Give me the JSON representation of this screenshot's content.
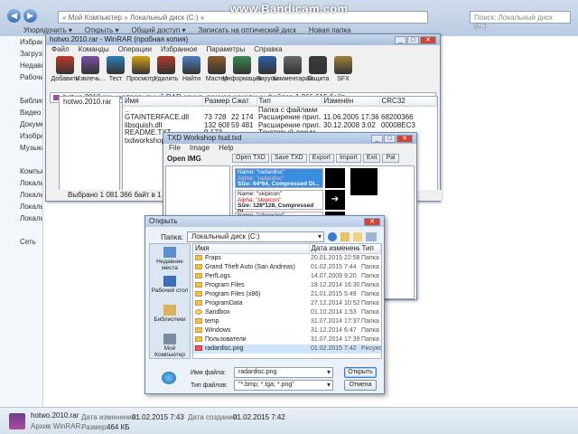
{
  "watermark": "www.Bandicam.com",
  "explorer": {
    "address": "« Мой Компьютер » Локальный диск (C:) »",
    "search_placeholder": "Поиск: Локальный диск (C:)",
    "commands": [
      "Упорядочить ▾",
      "Открыть ▾",
      "Общий доступ ▾",
      "Записать на оптический диск",
      "Новая папка"
    ],
    "nav": [
      "Избранное",
      "Загрузки",
      "Недавние",
      "Рабочий",
      "",
      "Библиотеки",
      "Видео",
      "Документы",
      "Изображения",
      "Музыка",
      "",
      "Компьютер",
      "Локальный",
      "Локальный",
      "Локальный",
      "Локальный",
      "",
      "Сеть"
    ],
    "status": {
      "filename": "hotwo.2010.rar",
      "type": "Архив WinRAR",
      "modified_label": "Дата изменения:",
      "modified": "01.02.2015 7:43",
      "created_label": "Дата создания:",
      "created": "01.02.2015 7:42",
      "size_label": "Размер:",
      "size": "464 КБ"
    }
  },
  "winrar": {
    "title": "hotwo.2010.rar - WinRAR (пробная копия)",
    "menu": [
      "Файл",
      "Команды",
      "Операции",
      "Избранное",
      "Параметры",
      "Справка"
    ],
    "toolbar": [
      "Добавить",
      "Извлечь...",
      "Тест",
      "Просмотр",
      "Удалить",
      "Найти",
      "Мастер",
      "Информация",
      "Вирусы",
      "Комментарий",
      "Защита",
      "SFX"
    ],
    "path": "hotwo.2010.rar - непрерывный RAR архив, размер исходных файлов 1 266 615 байт",
    "tree": [
      "hotwo.2010.rar"
    ],
    "columns": [
      "Имя",
      "Размер",
      "Сжат",
      "Тип",
      "Изменён",
      "CRC32"
    ],
    "rows": [
      [
        "..",
        "",
        "",
        "Папка с файлами",
        "",
        ""
      ],
      [
        "GTAINTERFACE.dll",
        "73 728",
        "22 174",
        "Расширение прил...",
        "11.06.2005 17:36",
        "68200366"
      ],
      [
        "libsquish.dll",
        "132 608",
        "59 481",
        "Расширение прил...",
        "30.12.2008 3:02",
        "00008EC3"
      ],
      [
        "README.TXT",
        "9 173",
        "",
        "Текстовый докум...",
        "",
        ""
      ],
      [
        "txdworkshop.exe",
        "",
        "",
        "",
        "",
        ""
      ]
    ],
    "status": "Выбрано 1 081 366 байт в 1 файле"
  },
  "txd": {
    "title": "TXD Workshop hud.txd",
    "menu": [
      "File",
      "Image",
      "Help"
    ],
    "toolbar": [
      "Open TXD",
      "Save TXD",
      "Export",
      "Import",
      "Exit",
      "Pal"
    ],
    "left_label": "Open IMG",
    "textures": [
      {
        "name": "Name: \"radardisc\"",
        "alpha": "Alpha: \"radardisc\"",
        "size": "Size: 64*64, Compressed DI..."
      },
      {
        "name": "Name: \"skipicon\"",
        "alpha": "Alpha: \"skipicon\"",
        "size": "Size: 128*128, Compressed DI..."
      },
      {
        "name": "Name: \"siteroster\"",
        "alpha": "",
        "size": ""
      }
    ]
  },
  "open_dialog": {
    "title": "Открыть",
    "lookin_label": "Папка:",
    "lookin_value": "Локальный диск (C:)",
    "places": [
      "Недавние места",
      "Рабочий стол",
      "Библиотеки",
      "Мой Компьютер",
      "Сеть"
    ],
    "columns": [
      "Имя",
      "Дата изменения",
      "Тип"
    ],
    "files": [
      {
        "name": "Fraps",
        "date": "20.01.2015 22:58",
        "type": "Папка с ф",
        "icon": "folder"
      },
      {
        "name": "Grand Theft Auto (San Andreas)",
        "date": "01.02.2015 7:44",
        "type": "Папка с ф",
        "icon": "folder"
      },
      {
        "name": "PerfLogs",
        "date": "14.07.2009 9:20",
        "type": "Папка с ф",
        "icon": "folder"
      },
      {
        "name": "Program Files",
        "date": "18.12.2014 16:30",
        "type": "Папка с ф",
        "icon": "folder"
      },
      {
        "name": "Program Files (x86)",
        "date": "21.01.2015 5:49",
        "type": "Папка с ф",
        "icon": "folder"
      },
      {
        "name": "ProgramData",
        "date": "27.12.2014 10:52",
        "type": "Папка с ф",
        "icon": "folder"
      },
      {
        "name": "Sandbox",
        "date": "01.10.2014 1:53",
        "type": "Папка с ф",
        "icon": "sandbox"
      },
      {
        "name": "temp",
        "date": "31.07.2014 17:37",
        "type": "Папка с ф",
        "icon": "folder"
      },
      {
        "name": "Windows",
        "date": "31.12.2014 6:47",
        "type": "Папка с ф",
        "icon": "folder"
      },
      {
        "name": "Пользователи",
        "date": "31.07.2014 17:39",
        "type": "Папка с ф",
        "icon": "folder"
      },
      {
        "name": "radardisc.png",
        "date": "01.02.2015 7:42",
        "type": "Рисунок I",
        "icon": "image"
      }
    ],
    "filename_label": "Имя файла:",
    "filename_value": "radardisc.png",
    "filetype_label": "Тип файлов:",
    "filetype_value": "\"*.bmp; *.tga; *.png\"",
    "open_button": "Открыть",
    "cancel_button": "Отмена"
  },
  "colors": {
    "accent": "#3b8de0",
    "selection": "#cfe3fb",
    "titlebar": "#b7cce6",
    "close": "#c9473b"
  }
}
